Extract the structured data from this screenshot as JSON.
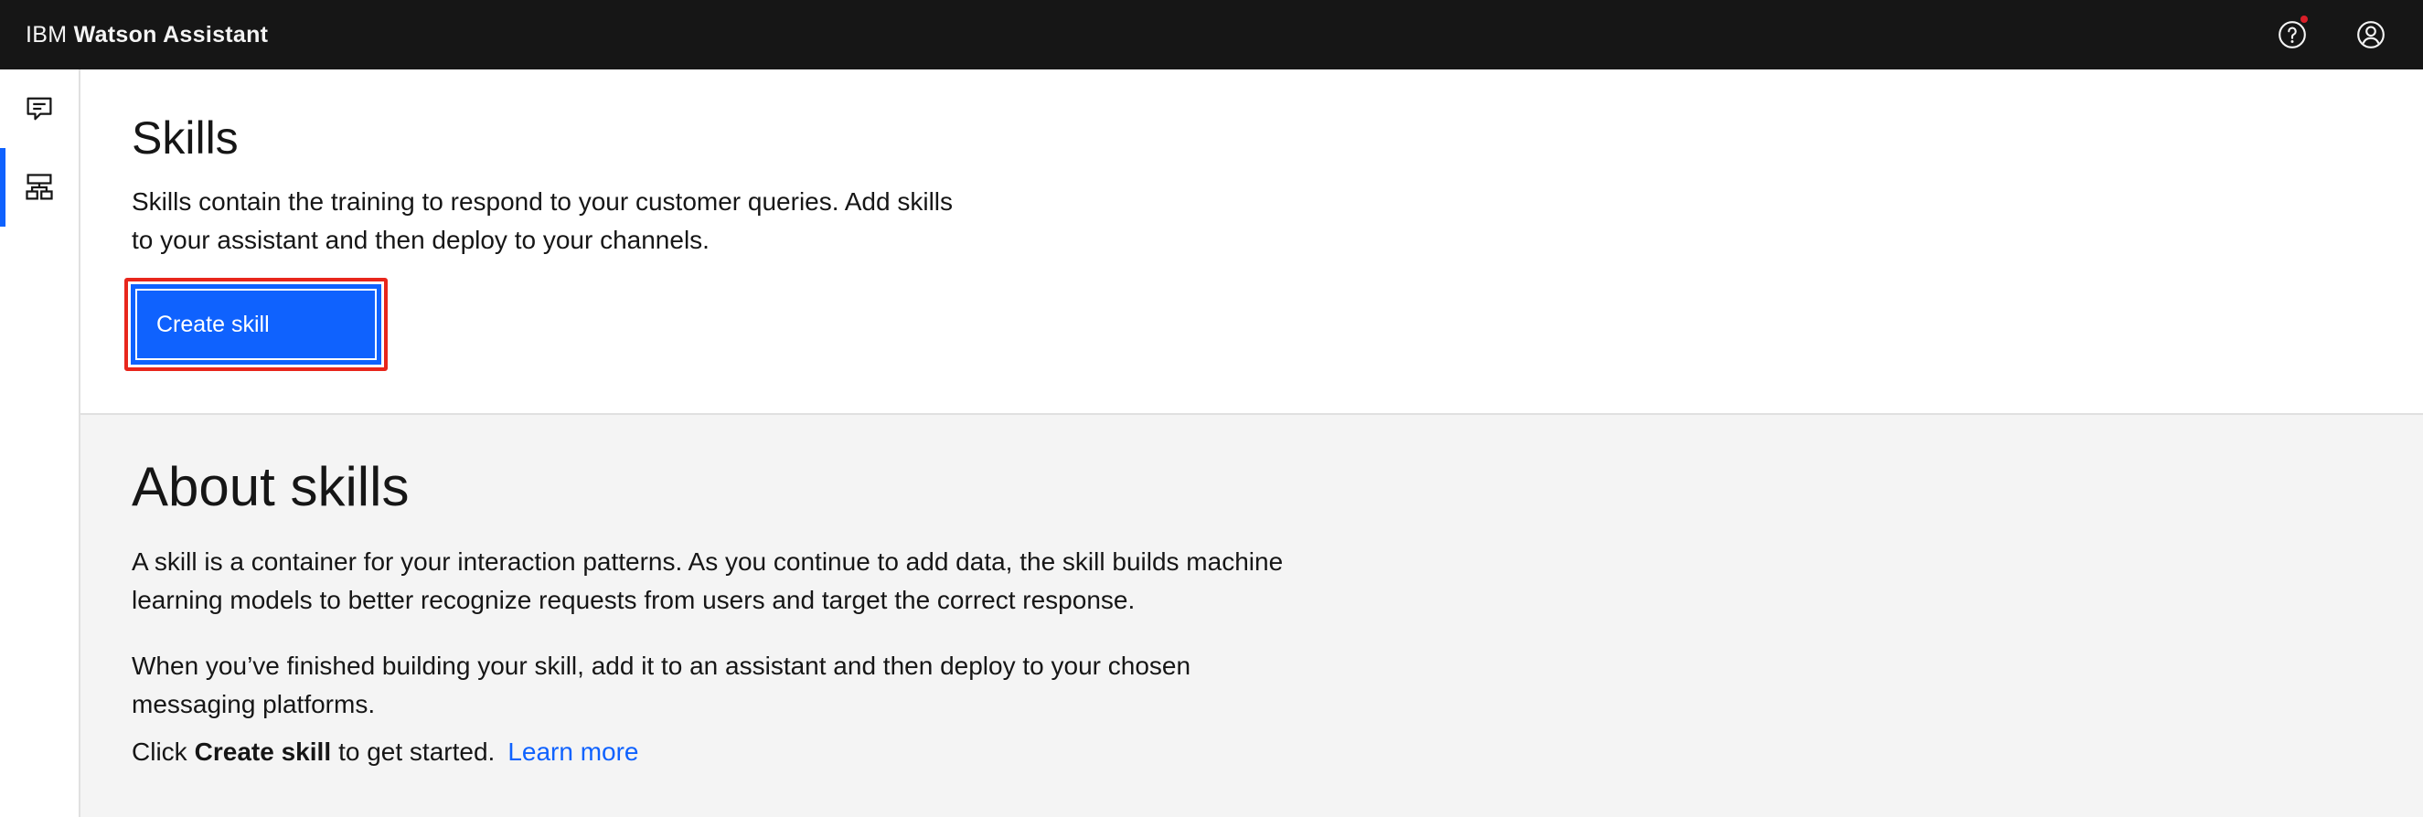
{
  "header": {
    "brand_prefix": "IBM",
    "brand_name": "Watson Assistant",
    "icons": [
      "help-icon",
      "user-avatar-icon"
    ]
  },
  "sidenav": {
    "items": [
      {
        "name": "assistants",
        "icon": "chat-icon",
        "active": false
      },
      {
        "name": "skills",
        "icon": "skills-tree-icon",
        "active": true
      }
    ]
  },
  "skills": {
    "title": "Skills",
    "description": "Skills contain the training to respond to your customer queries. Add skills to your assistant and then deploy to your channels.",
    "create_button": "Create skill"
  },
  "about": {
    "title": "About skills",
    "paragraph1": "A skill is a container for your interaction patterns. As you continue to add data, the skill builds machine learning models to better recognize requests from users and target the correct response.",
    "paragraph2": "When you’ve finished building your skill, add it to an assistant and then deploy to your chosen messaging platforms.",
    "cta_prefix": "Click",
    "cta_bold": "Create skill",
    "cta_suffix": "to get started.",
    "learn_more": "Learn more"
  },
  "colors": {
    "header_bg": "#161616",
    "accent": "#0f62fe",
    "highlight": "#e8261c",
    "about_bg": "#f4f4f4"
  }
}
